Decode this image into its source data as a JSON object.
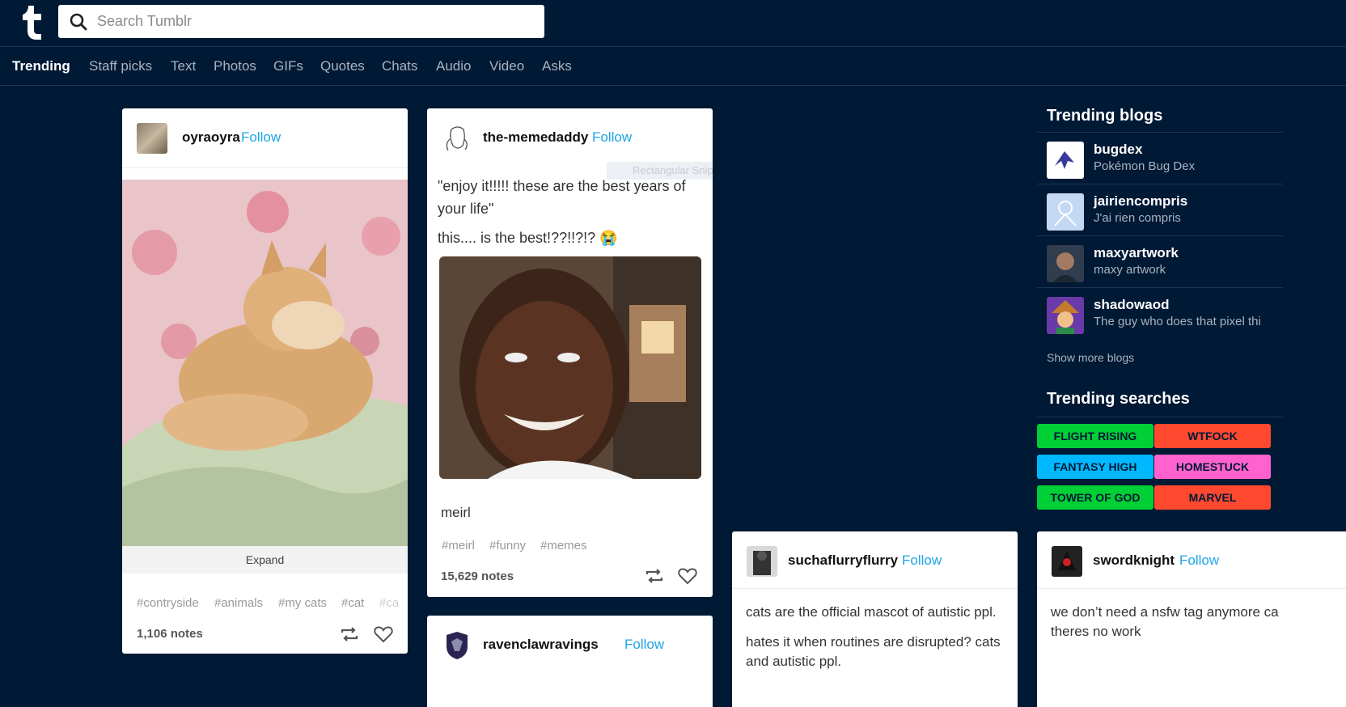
{
  "search": {
    "placeholder": "Search Tumblr"
  },
  "nav": [
    "Trending",
    "Staff picks",
    "Text",
    "Photos",
    "GIFs",
    "Quotes",
    "Chats",
    "Audio",
    "Video",
    "Asks"
  ],
  "posts": [
    {
      "blog": "oyraoyra",
      "follow": "Follow",
      "expand": "Expand",
      "tags": [
        "#contryside",
        "#animals",
        "#my cats",
        "#cat",
        "#ca"
      ],
      "notes": "1,106 notes"
    },
    {
      "blog": "the-memedaddy",
      "follow": "Follow",
      "text1": "\"enjoy it!!!!! these are the best years of your life\"",
      "text2": "this.... is the best!??!!?!? 😭",
      "caption": "meirl",
      "tags": [
        "#meirl",
        "#funny",
        "#memes"
      ],
      "notes": "15,629 notes",
      "overlay": "Rectangular Snip"
    },
    {
      "blog": "ravenclawravings",
      "follow": "Follow"
    },
    {
      "blog": "suchaflurryflurry",
      "follow": "Follow",
      "text1": "cats are the official mascot of autistic ppl.",
      "text2": "hates it when routines are disrupted? cats and autistic ppl."
    },
    {
      "blog": "swordknight",
      "follow": "Follow",
      "text1": "we don’t need a nsfw tag anymore ca theres no work"
    }
  ],
  "sidebar": {
    "trending_blogs_title": "Trending blogs",
    "blogs": [
      {
        "name": "bugdex",
        "desc": "Pokémon Bug Dex"
      },
      {
        "name": "jairiencompris",
        "desc": "J'ai rien compris"
      },
      {
        "name": "maxyartwork",
        "desc": "maxy artwork"
      },
      {
        "name": "shadowaod",
        "desc": "The guy who does that pixel thi"
      }
    ],
    "show_more": "Show more blogs",
    "trending_searches_title": "Trending searches",
    "searches": [
      {
        "label": "FLIGHT RISING",
        "color": "#00cf35"
      },
      {
        "label": "WTFOCK",
        "color": "#ff492f"
      },
      {
        "label": "FANTASY HIGH",
        "color": "#00b8ff"
      },
      {
        "label": "HOMESTUCK",
        "color": "#ff62ce"
      },
      {
        "label": "TOWER OF GOD",
        "color": "#00cf35"
      },
      {
        "label": "MARVEL",
        "color": "#ff492f"
      }
    ]
  },
  "icons": [
    "tumblr-logo-icon",
    "search-icon",
    "reblog-icon",
    "heart-icon"
  ]
}
